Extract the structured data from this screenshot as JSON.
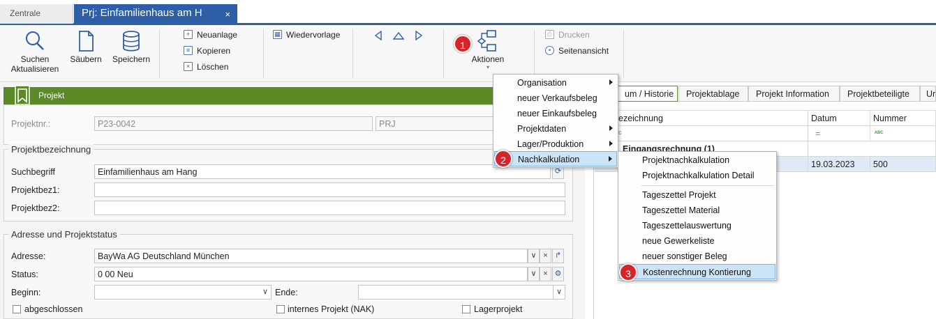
{
  "tabs": {
    "inactive": "Zentrale",
    "active": "Prj: Einfamilienhaus am H",
    "close": "×"
  },
  "ribbon": {
    "suchen": "Suchen",
    "aktualisieren": "Aktualisieren",
    "saeubern": "Säubern",
    "speichern": "Speichern",
    "neuanlage": "Neuanlage",
    "kopieren": "Kopieren",
    "loeschen": "Löschen",
    "wiedervorlage": "Wiedervorlage",
    "aktionen": "Aktionen",
    "drucken": "Drucken",
    "seitenansicht": "Seitenansicht"
  },
  "left": {
    "section_title": "Projekt",
    "projektnr_label": "Projektnr.:",
    "projektnr_value": "P23-0042",
    "projektnr_type": "PRJ",
    "bez_group": "Projektbezeichnung",
    "suchbegriff_label": "Suchbegriff",
    "suchbegriff_value": "Einfamilienhaus am Hang",
    "bez1_label": "Projektbez1:",
    "bez2_label": "Projektbez2:",
    "adresse_group": "Adresse und Projektstatus",
    "adresse_label": "Adresse:",
    "adresse_value": "BayWa AG Deutschland München",
    "status_label": "Status:",
    "status_value": "0 00 Neu",
    "beginn_label": "Beginn:",
    "ende_label": "Ende:",
    "abgeschlossen": "abgeschlossen",
    "intern": "internes Projekt (NAK)",
    "lager": "Lagerprojekt"
  },
  "right": {
    "tabs": [
      "um / Historie",
      "Projektablage",
      "Projekt Information",
      "Projektbeteiligte",
      "Ur"
    ],
    "col_bez": "ezeichnung",
    "col_datum": "Datum",
    "col_nummer": "Nummer",
    "filter_equals": "=",
    "filter_abc": "ᴀʙᴄ",
    "filter_c": "c",
    "group_row": "Eingangsrechnung (1)",
    "row_datum": "19.03.2023",
    "row_nummer": "500"
  },
  "menu1": {
    "items": [
      "Organisation",
      "neuer Verkaufsbeleg",
      "neuer Einkaufsbeleg",
      "Projektdaten",
      "Lager/Produktion",
      "Nachkalkulation"
    ]
  },
  "menu2": {
    "items": [
      "Projektnachkalkulation",
      "Projektnachkalkulation Detail",
      "Tageszettel Projekt",
      "Tageszettel Material",
      "Tageszettelauswertung",
      "neue Gewerkeliste",
      "neuer sonstiger Beleg",
      "Kostenrechnung Kontierung"
    ]
  },
  "badges": [
    "1",
    "2",
    "3"
  ],
  "colors": {
    "accent_blue": "#2e5ea6",
    "project_green": "#5c8a26",
    "badge_red": "#d7242b",
    "highlight": "#cce4f7"
  }
}
